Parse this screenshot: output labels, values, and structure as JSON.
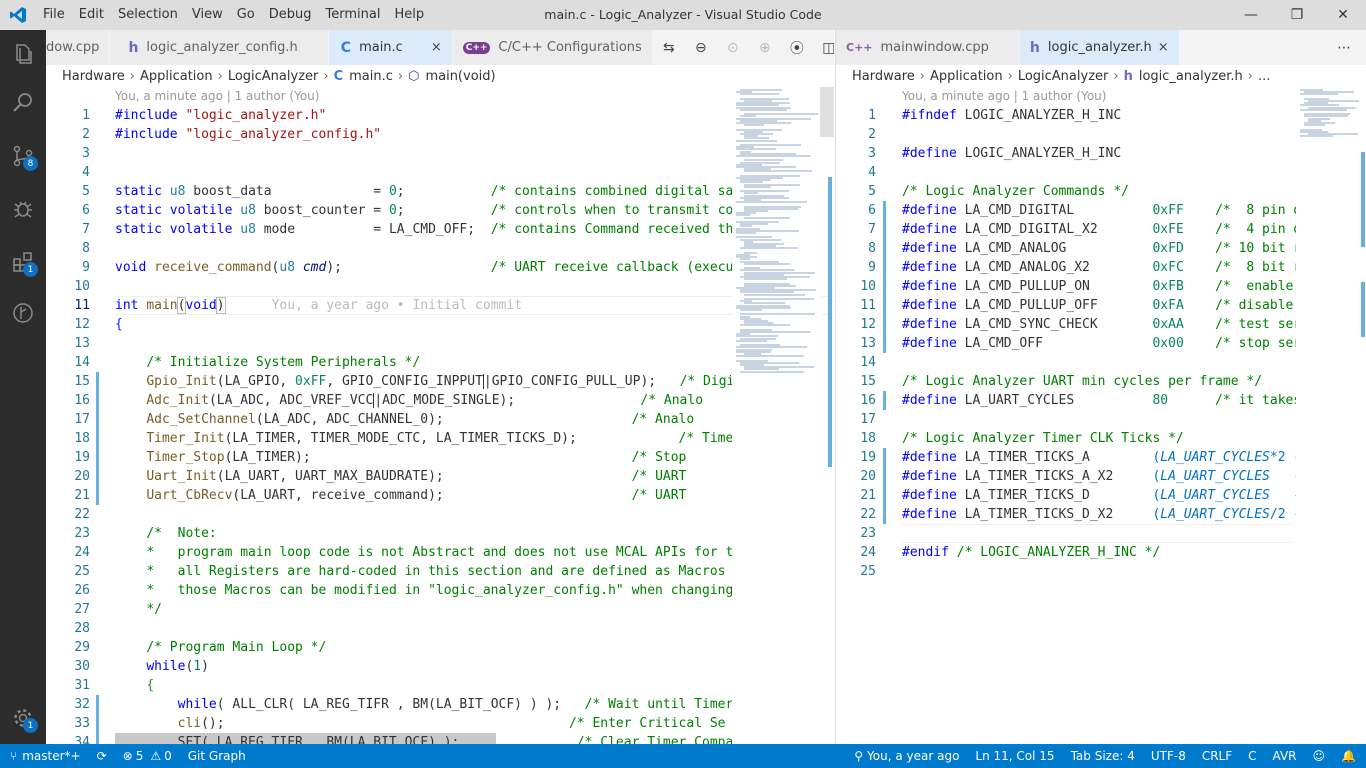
{
  "window": {
    "title": "main.c - Logic_Analyzer - Visual Studio Code",
    "menu": [
      "File",
      "Edit",
      "Selection",
      "View",
      "Go",
      "Debug",
      "Terminal",
      "Help"
    ]
  },
  "activity": {
    "scm_badge": "8",
    "ext_badge": "1",
    "settings_badge": "1"
  },
  "left": {
    "tabs": [
      {
        "label": "dow.cpp",
        "icon": ""
      },
      {
        "label": "logic_analyzer_config.h",
        "icon": "h"
      },
      {
        "label": "main.c",
        "icon": "C",
        "close": "×"
      },
      {
        "label": "C/C++ Configurations",
        "icon": "C++"
      }
    ],
    "breadcrumb": [
      "Hardware",
      "Application",
      "LogicAnalyzer",
      "main.c",
      "main(void)"
    ],
    "codelens": "You, a minute ago | 1 author (You)",
    "blame": "You, a year ago • Initial commit"
  },
  "right": {
    "tabs": [
      {
        "label": "mainwindow.cpp",
        "icon": "C++"
      },
      {
        "label": "logic_analyzer.h",
        "icon": "h",
        "close": "×"
      }
    ],
    "breadcrumb": [
      "Hardware",
      "Application",
      "LogicAnalyzer",
      "logic_analyzer.h",
      "..."
    ],
    "codelens": "You, a minute ago | 1 author (You)"
  },
  "status": {
    "branch": "master*+",
    "sync": "⟳",
    "errors": "5",
    "warnings": "0",
    "git_graph": "Git Graph",
    "blame": "You, a year ago",
    "position": "Ln 11, Col 15",
    "tab_size": "Tab Size: 4",
    "encoding": "UTF-8",
    "eol": "CRLF",
    "language": "C",
    "config": "AVR",
    "feedback": "☺",
    "bell": "🔔"
  },
  "colors": {
    "accent": "#007acc",
    "activity_bg": "#2c2c2c",
    "titlebar_bg": "#dddddd"
  }
}
